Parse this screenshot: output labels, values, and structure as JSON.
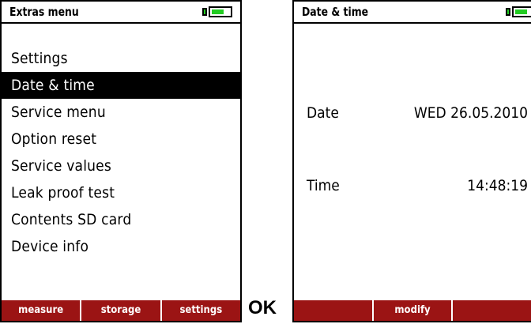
{
  "left_screen": {
    "title": "Extras menu",
    "battery_level": 0.7,
    "menu_items": [
      {
        "label": "Settings",
        "selected": false
      },
      {
        "label": "Date & time",
        "selected": true
      },
      {
        "label": "Service menu",
        "selected": false
      },
      {
        "label": "Option reset",
        "selected": false
      },
      {
        "label": "Service values",
        "selected": false
      },
      {
        "label": "Leak proof test",
        "selected": false
      },
      {
        "label": "Contents SD card",
        "selected": false
      },
      {
        "label": "Device info",
        "selected": false
      }
    ],
    "softkeys": [
      "measure",
      "storage",
      "settings"
    ]
  },
  "ok_label": "OK",
  "right_screen": {
    "title": "Date & time",
    "battery_level": 0.7,
    "date_label": "Date",
    "date_value": "WED 26.05.2010",
    "time_label": "Time",
    "time_value": "14:48:19",
    "softkeys": [
      "",
      "modify",
      ""
    ]
  },
  "colors": {
    "softkey_bar": "#9b1414",
    "battery_fill": "#22cc22",
    "selected_bg": "#000000"
  },
  "icons": {
    "battery": "battery-icon"
  }
}
